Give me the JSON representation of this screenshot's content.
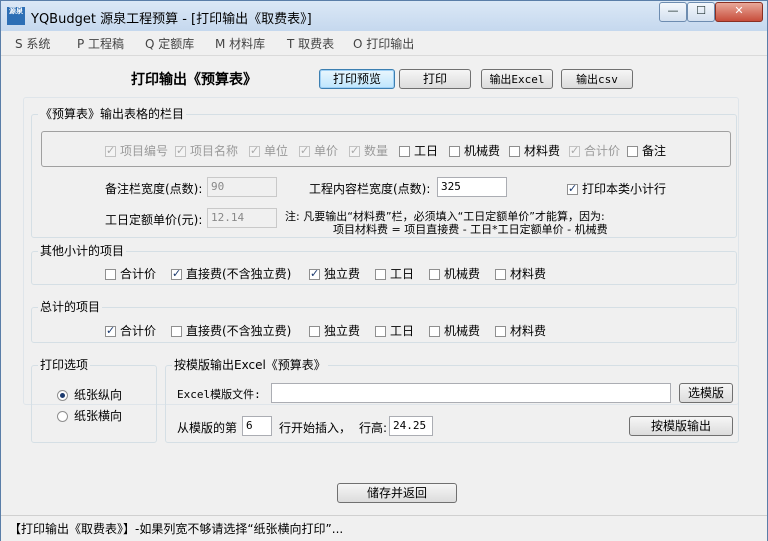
{
  "window": {
    "title": "YQBudget 源泉工程预算 - [打印输出《取费表》]",
    "icon_text": "源泉",
    "controls": {
      "minimize": "—",
      "maximize": "☐",
      "close": "✕"
    }
  },
  "menu": [
    "S 系统",
    "P 工程稿",
    "Q 定额库",
    "M 材料库",
    "T 取费表",
    "O 打印输出"
  ],
  "header": {
    "title": "打印输出《预算表》",
    "buttons": {
      "preview": "打印预览",
      "print": "打印",
      "excel": "输出Excel",
      "csv": "输出csv"
    }
  },
  "columns_group": {
    "label": "《预算表》输出表格的栏目",
    "items": [
      {
        "label": "项目编号",
        "checked": true,
        "enabled": false
      },
      {
        "label": "项目名称",
        "checked": true,
        "enabled": false
      },
      {
        "label": "单位",
        "checked": true,
        "enabled": false
      },
      {
        "label": "单价",
        "checked": true,
        "enabled": false
      },
      {
        "label": "数量",
        "checked": true,
        "enabled": false
      },
      {
        "label": "工日",
        "checked": false,
        "enabled": true
      },
      {
        "label": "机械费",
        "checked": false,
        "enabled": true
      },
      {
        "label": "材料费",
        "checked": false,
        "enabled": true
      },
      {
        "label": "合计价",
        "checked": true,
        "enabled": false
      },
      {
        "label": "备注",
        "checked": false,
        "enabled": true
      }
    ],
    "remark_width_label": "备注栏宽度(点数):",
    "remark_width_value": "90",
    "content_width_label": "工程内容栏宽度(点数):",
    "content_width_value": "325",
    "print_subtotal_label": "打印本类小计行",
    "labor_price_label": "工日定额单价(元):",
    "labor_price_value": "12.14",
    "note_line1": "注: 凡要输出“材料费”栏，必须填入“工日定额单价”才能算，因为:",
    "note_line2": "项目材料费 = 项目直接费 - 工日*工日定额单价 - 机械费"
  },
  "subtotal_group": {
    "label": "其他小计的项目",
    "items": [
      {
        "label": "合计价",
        "checked": false
      },
      {
        "label": "直接费(不含独立费)",
        "checked": true
      },
      {
        "label": "独立费",
        "checked": true
      },
      {
        "label": "工日",
        "checked": false
      },
      {
        "label": "机械费",
        "checked": false
      },
      {
        "label": "材料费",
        "checked": false
      }
    ]
  },
  "total_group": {
    "label": "总计的项目",
    "items": [
      {
        "label": "合计价",
        "checked": true
      },
      {
        "label": "直接费(不含独立费)",
        "checked": false
      },
      {
        "label": "独立费",
        "checked": false
      },
      {
        "label": "工日",
        "checked": false
      },
      {
        "label": "机械费",
        "checked": false
      },
      {
        "label": "材料费",
        "checked": false
      }
    ]
  },
  "print_options": {
    "label": "打印选项",
    "portrait": "纸张纵向",
    "landscape": "纸张横向",
    "selected": "portrait"
  },
  "template_group": {
    "label": "按模版输出Excel《预算表》",
    "file_label": "Excel模版文件:",
    "file_value": "",
    "choose_button": "选模版",
    "row_prefix": "从模版的第",
    "row_value": "6",
    "row_suffix": "行开始插入，",
    "height_label": "行高:",
    "height_value": "24.25",
    "output_button": "按模版输出"
  },
  "footer": {
    "save_button": "储存并返回"
  },
  "status": {
    "text": "【打印输出《取费表》】-如果列宽不够请选择“纸张横向打印”..."
  }
}
